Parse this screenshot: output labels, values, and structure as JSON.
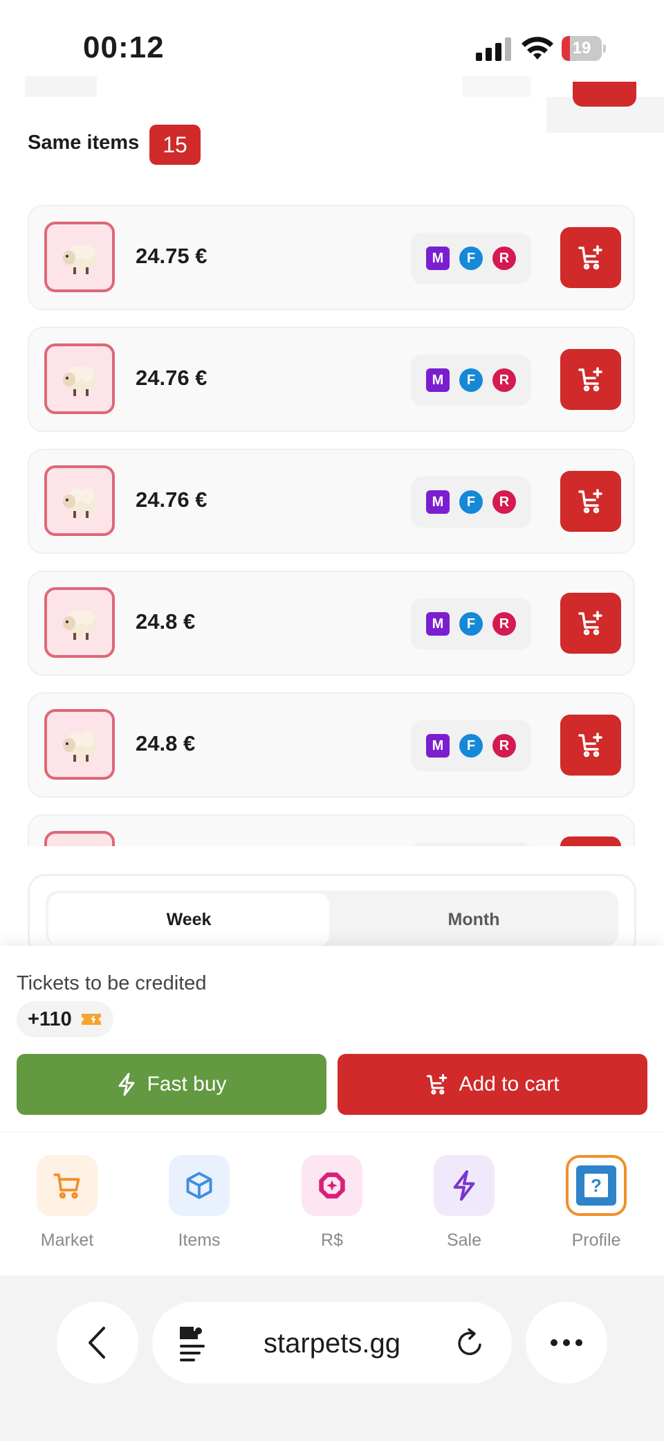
{
  "status_bar": {
    "time": "00:12",
    "battery": "19"
  },
  "same_items": {
    "label": "Same items",
    "count": "15"
  },
  "listings": [
    {
      "price": "24.75 €",
      "tags": [
        "M",
        "F",
        "R"
      ]
    },
    {
      "price": "24.76 €",
      "tags": [
        "M",
        "F",
        "R"
      ]
    },
    {
      "price": "24.76 €",
      "tags": [
        "M",
        "F",
        "R"
      ]
    },
    {
      "price": "24.8 €",
      "tags": [
        "M",
        "F",
        "R"
      ]
    },
    {
      "price": "24.8 €",
      "tags": [
        "M",
        "F",
        "R"
      ]
    },
    {
      "price": "",
      "tags": []
    }
  ],
  "period_tabs": {
    "week": "Week",
    "month": "Month",
    "selected": "Week"
  },
  "tickets": {
    "label": "Tickets to be credited",
    "value": "+110"
  },
  "actions": {
    "fast_buy": "Fast buy",
    "add_to_cart": "Add to cart"
  },
  "nav": [
    {
      "label": "Market",
      "icon": "cart-icon",
      "color": "#f0902a",
      "bg": "#fff1e3"
    },
    {
      "label": "Items",
      "icon": "box-icon",
      "color": "#3f8ee0",
      "bg": "#e8f1fd"
    },
    {
      "label": "R$",
      "icon": "robux-icon",
      "color": "#d8207a",
      "bg": "#fde6f1"
    },
    {
      "label": "Sale",
      "icon": "lightning-icon",
      "color": "#7a34d0",
      "bg": "#f0e9fb"
    },
    {
      "label": "Profile",
      "icon": "avatar-icon",
      "color": "#f0902a",
      "bg": "#ffffff"
    }
  ],
  "browser": {
    "url": "starpets.gg"
  },
  "colors": {
    "accent_red": "#d02a2a",
    "accent_green": "#639940"
  }
}
